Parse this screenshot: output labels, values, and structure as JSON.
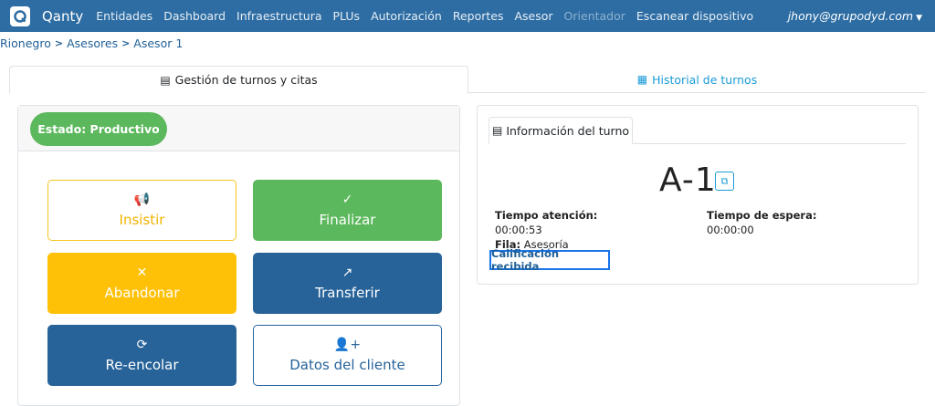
{
  "navbar": {
    "brand": "Qanty",
    "items": [
      {
        "label": "Entidades",
        "disabled": false
      },
      {
        "label": "Dashboard",
        "disabled": false
      },
      {
        "label": "Infraestructura",
        "disabled": false
      },
      {
        "label": "PLUs",
        "disabled": false
      },
      {
        "label": "Autorización",
        "disabled": false
      },
      {
        "label": "Reportes",
        "disabled": false
      },
      {
        "label": "Asesor",
        "disabled": false
      },
      {
        "label": "Orientador",
        "disabled": true
      },
      {
        "label": "Escanear dispositivo",
        "disabled": false
      }
    ],
    "user": "jhony@grupodyd.com"
  },
  "breadcrumb": [
    "Rionegro",
    "Asesores",
    "Asesor 1"
  ],
  "tabs": {
    "gestion": "Gestión de turnos y citas",
    "historial": "Historial de turnos"
  },
  "status": "Estado: Productivo",
  "actions": {
    "insistir": "Insistir",
    "finalizar": "Finalizar",
    "abandonar": "Abandonar",
    "transferir": "Transferir",
    "reencolar": "Re-encolar",
    "datos_cliente": "Datos del cliente"
  },
  "info": {
    "tab": "Información del turno",
    "ticket": "A-1",
    "tiempo_atencion_label": "Tiempo atención:",
    "tiempo_atencion": "00:00:53",
    "tiempo_espera_label": "Tiempo de espera:",
    "tiempo_espera": "00:00:00",
    "fila_label": "Fila:",
    "fila": "Asesoría",
    "calificacion": "Calificación recibida"
  },
  "colors": {
    "navbar": "#2d6da3",
    "success": "#5cb85c",
    "warning": "#ffc107",
    "primary": "#276399",
    "link": "#1a9bd7"
  },
  "icons": [
    "qanty-logo-icon",
    "document-icon",
    "table-icon",
    "megaphone-icon",
    "check-icon",
    "times-icon",
    "share-icon",
    "sync-icon",
    "user-plus-icon",
    "copy-icon"
  ]
}
